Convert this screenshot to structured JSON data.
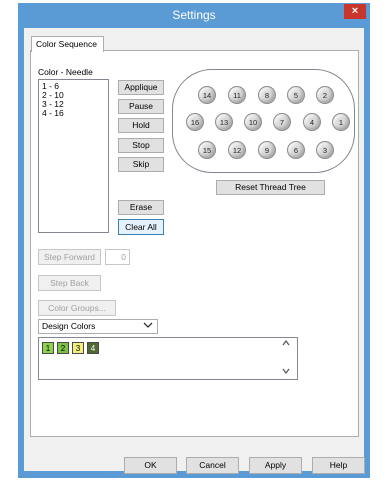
{
  "window": {
    "title": "Settings",
    "close_glyph": "×"
  },
  "tabs": [
    {
      "label": "Color Sequence"
    }
  ],
  "color_needle": {
    "label": "Color - Needle",
    "items": [
      "1  -  6",
      "2  -  10",
      "3  -  12",
      "4  -  16"
    ]
  },
  "actions": {
    "applique": "Applique",
    "pause": "Pause",
    "hold": "Hold",
    "stop": "Stop",
    "skip": "Skip",
    "erase": "Erase",
    "clear_all": "Clear All"
  },
  "thread_tree": {
    "row1": [
      "14",
      "11",
      "8",
      "5",
      "2"
    ],
    "row2": [
      "16",
      "13",
      "10",
      "7",
      "4",
      "1"
    ],
    "row3": [
      "15",
      "12",
      "9",
      "6",
      "3"
    ],
    "reset_label": "Reset Thread Tree"
  },
  "step": {
    "forward_label": "Step Forward",
    "forward_value": "0",
    "back_label": "Step Back",
    "color_groups_label": "Color Groups..."
  },
  "design_colors": {
    "selected": "Design Colors",
    "swatches": [
      {
        "number": "1",
        "color": "#8fd14f"
      },
      {
        "number": "2",
        "color": "#7cc242"
      },
      {
        "number": "3",
        "color": "#f2f07a"
      },
      {
        "number": "4",
        "color": "#4f6b32"
      }
    ]
  },
  "footer": {
    "ok": "OK",
    "cancel": "Cancel",
    "apply": "Apply",
    "help": "Help"
  }
}
